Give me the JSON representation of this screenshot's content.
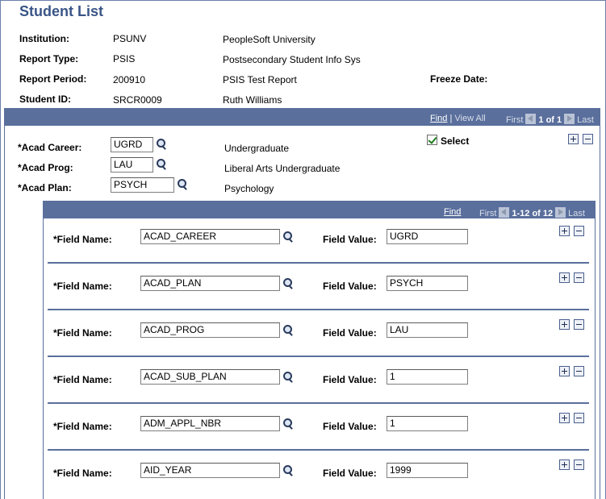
{
  "page": {
    "title": "Student List"
  },
  "header": {
    "institution": {
      "label": "Institution:",
      "code": "PSUNV",
      "desc": "PeopleSoft University"
    },
    "report_type": {
      "label": "Report Type:",
      "code": "PSIS",
      "desc": "Postsecondary Student Info Sys"
    },
    "report_period": {
      "label": "Report Period:",
      "code": "200910",
      "desc": "PSIS Test Report"
    },
    "freeze_date": {
      "label": "Freeze Date:"
    },
    "student_id": {
      "label": "Student ID:",
      "code": "SRCR0009",
      "desc": "Ruth Williams"
    }
  },
  "outer_nav": {
    "find": "Find",
    "sep": "|",
    "view_all": "View All",
    "first": "First",
    "count": "1 of 1",
    "last": "Last"
  },
  "acad": {
    "career": {
      "label": "*Acad Career:",
      "value": "UGRD",
      "desc": "Undergraduate"
    },
    "prog": {
      "label": "*Acad Prog:",
      "value": "LAU",
      "desc": "Liberal Arts Undergraduate"
    },
    "plan": {
      "label": "*Acad Plan:",
      "value": "PSYCH",
      "desc": "Psychology"
    },
    "select_label": "Select",
    "select_checked": true
  },
  "inner_nav": {
    "find": "Find",
    "first": "First",
    "count": "1-12 of 12",
    "last": "Last"
  },
  "field_labels": {
    "name": "*Field Name:",
    "value": "Field Value:"
  },
  "fields": [
    {
      "name": "ACAD_CAREER",
      "value": "UGRD"
    },
    {
      "name": "ACAD_PLAN",
      "value": "PSYCH"
    },
    {
      "name": "ACAD_PROG",
      "value": "LAU"
    },
    {
      "name": "ACAD_SUB_PLAN",
      "value": "1"
    },
    {
      "name": "ADM_APPL_NBR",
      "value": "1"
    },
    {
      "name": "AID_YEAR",
      "value": "1999"
    }
  ],
  "colors": {
    "bar": "#5a6f9c",
    "title": "#3a5587"
  }
}
